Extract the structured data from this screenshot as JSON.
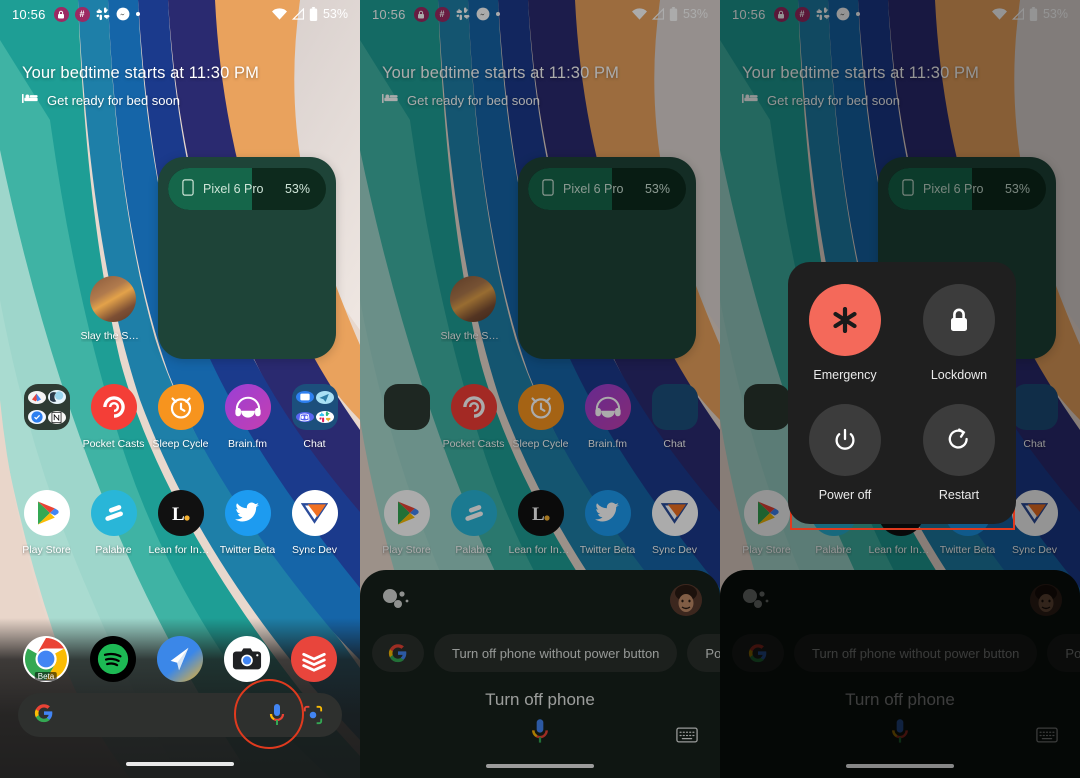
{
  "status_bar": {
    "clock": "10:56",
    "badge1": "⌂",
    "badge2": "#",
    "slack_icon": "slack-icon",
    "messenger_icon": "messenger-icon",
    "overflow_dot": "more-notifications-dot",
    "wifi_icon": "wifi-icon",
    "signal_icon": "cellular-signal-icon",
    "battery_icon": "battery-icon",
    "battery_percent": "53%"
  },
  "glance": {
    "title": "Your bedtime starts at 11:30 PM",
    "subtitle": "Get ready for bed soon",
    "icon": "bed-icon"
  },
  "battery_widget": {
    "device_name": "Pixel 6 Pro",
    "percent_label": "53%",
    "percent_value": 53,
    "phone_icon": "phone-icon",
    "widget_color": "#1e4438",
    "fill_color": "#15664a"
  },
  "home": {
    "slay_row": [
      {
        "label": "Slay the Spire",
        "icon": "slay-the-spire-icon"
      }
    ],
    "row1": [
      {
        "label": "",
        "icon": "folder-icon",
        "type": "folder-dark"
      },
      {
        "label": "Pocket Casts",
        "icon": "pocket-casts-icon"
      },
      {
        "label": "Sleep Cycle",
        "icon": "sleep-cycle-icon"
      },
      {
        "label": "Brain.fm",
        "icon": "brain-fm-icon"
      },
      {
        "label": "Chat",
        "icon": "folder-icon",
        "type": "folder-blue"
      }
    ],
    "row2": [
      {
        "label": "Play Store",
        "icon": "play-store-icon"
      },
      {
        "label": "Palabre",
        "icon": "palabre-icon"
      },
      {
        "label": "Lean for Inst…",
        "icon": "lean-for-instagram-icon"
      },
      {
        "label": "Twitter Beta",
        "icon": "twitter-icon"
      },
      {
        "label": "Sync Dev",
        "icon": "sync-dev-icon"
      }
    ],
    "dock": [
      {
        "label": "Chrome Beta",
        "icon": "chrome-icon",
        "badge": "Beta"
      },
      {
        "label": "Spotify",
        "icon": "spotify-icon"
      },
      {
        "label": "Spark",
        "icon": "spark-mail-icon"
      },
      {
        "label": "Camera",
        "icon": "camera-icon"
      },
      {
        "label": "Todoist",
        "icon": "todoist-icon"
      }
    ]
  },
  "search": {
    "google_icon": "google-g-icon",
    "mic_icon": "microphone-icon",
    "lens_icon": "google-lens-icon",
    "placeholder": ""
  },
  "assistant": {
    "logo_icon": "google-assistant-icon",
    "avatar_icon": "user-avatar",
    "chips": [
      {
        "label": "",
        "icon": "google-g-icon"
      },
      {
        "label": "Turn off phone without power button"
      },
      {
        "label": "Power o"
      }
    ],
    "query": "Turn off phone",
    "mic_icon": "microphone-icon",
    "keyboard_icon": "keyboard-icon"
  },
  "power_menu": {
    "items": [
      {
        "label": "Emergency",
        "icon": "emergency-asterisk-icon",
        "color": "#f4695a"
      },
      {
        "label": "Lockdown",
        "icon": "lock-icon",
        "color": "#3c3c3c"
      },
      {
        "label": "Power off",
        "icon": "power-icon",
        "color": "#3c3c3c"
      },
      {
        "label": "Restart",
        "icon": "restart-icon",
        "color": "#3c3c3c"
      }
    ]
  },
  "annotations": {
    "accent_color": "#e03a1e",
    "mic_highlight": "circle-around-mic-button",
    "power_highlight": "rect-around-power-off-and-restart"
  }
}
